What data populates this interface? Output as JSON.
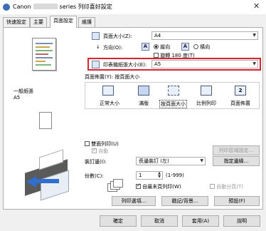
{
  "window": {
    "brand": "Canon",
    "title_suffix": "series 列印喜好設定",
    "close": "✕"
  },
  "tabs": [
    {
      "label": "快速設定"
    },
    {
      "label": "主要"
    },
    {
      "label": "頁面設定"
    },
    {
      "label": "維護"
    }
  ],
  "preview": {
    "media_label": "一般紙張",
    "size_label": "A5"
  },
  "page_size": {
    "label": "頁面大小(Z):",
    "value": "A4"
  },
  "orientation": {
    "label": "方向(O):",
    "portrait_label": "縱向",
    "landscape_label": "橫向",
    "rotate_label": "旋轉 180 度(T)",
    "selected": "portrait",
    "letter": "A"
  },
  "printer_paper_size": {
    "label": "印表機紙張大小(E):",
    "value": "A5"
  },
  "page_layout": {
    "label": "頁面佈置(Y): 按頁面大小",
    "options": [
      {
        "label": "正常大小"
      },
      {
        "label": "滿版"
      },
      {
        "label": "按頁面大小"
      },
      {
        "label": "比例列印"
      },
      {
        "label": "頁面佈置",
        "glyph": "2"
      }
    ],
    "selected_index": 2
  },
  "duplex": {
    "label": "雙面列印(U)",
    "checked": false,
    "auto_label": "自動",
    "auto_checked": true,
    "area_button": "列印區域設定..."
  },
  "binding": {
    "label": "裝訂邊(I):",
    "value": "長邊裝訂 (左)",
    "margin_button": "指定邊緣..."
  },
  "copies": {
    "label": "份數(C):",
    "value": "1",
    "range": "(1-999)",
    "last_page_first_label": "自最末頁列印(W)",
    "last_page_first_checked": true,
    "collate_label": "自動分頁(T)",
    "collate_checked": false
  },
  "panel_buttons": {
    "print_options": "列印選項...",
    "stamp_background": "戳記/背景...",
    "defaults": "預設(F)"
  },
  "footer_buttons": {
    "ok": "確定",
    "cancel": "取消",
    "apply": "套用(A)",
    "help": "說明"
  },
  "colors": {
    "highlight": "#d9232e",
    "accent": "#3a6db5"
  }
}
